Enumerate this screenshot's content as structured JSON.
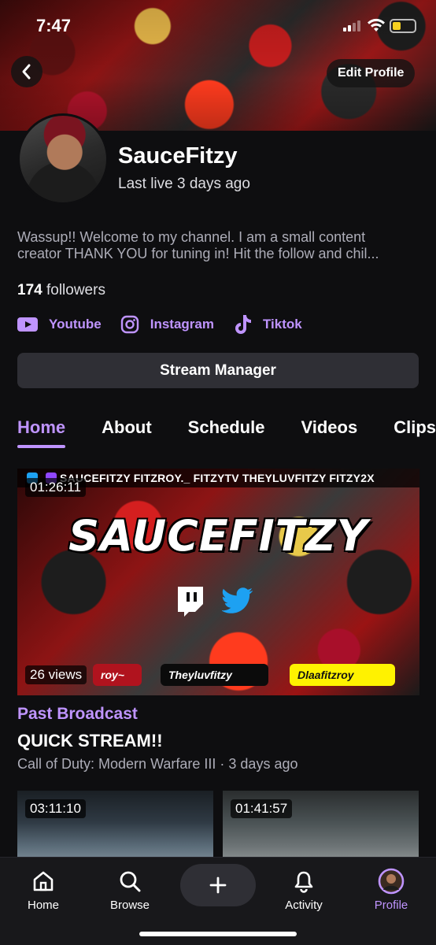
{
  "status_bar": {
    "time": "7:47"
  },
  "header": {
    "edit_profile_label": "Edit Profile"
  },
  "profile": {
    "channel_name": "SauceFitzy",
    "last_live": "Last live 3 days ago",
    "bio_line1": "Wassup!! Welcome to my channel. I am a small content",
    "bio_line2": "creator THANK YOU for tuning in! Hit the follow and chil...",
    "followers_count": "174",
    "followers_label": "followers"
  },
  "socials": [
    {
      "label": "Youtube",
      "icon": "youtube-icon"
    },
    {
      "label": "Instagram",
      "icon": "instagram-icon"
    },
    {
      "label": "Tiktok",
      "icon": "tiktok-icon"
    }
  ],
  "stream_manager_label": "Stream Manager",
  "tabs": [
    {
      "label": "Home",
      "active": true
    },
    {
      "label": "About"
    },
    {
      "label": "Schedule"
    },
    {
      "label": "Videos"
    },
    {
      "label": "Clips"
    }
  ],
  "featured": {
    "strip_text": "SAUCEFITZY  FITZROY._  FITZYTV  THEYLUVFITZY  FITZY2X",
    "thumb_title": "SAUCEFITZY",
    "duration": "01:26:11",
    "views": "26 views",
    "tags": [
      "roy~",
      "Theyluvfitzy",
      "Dlaafitzroy"
    ],
    "category": "Past Broadcast",
    "title": "QUICK STREAM!!",
    "meta": "Call of Duty: Modern Warfare III · 3 days ago"
  },
  "more_videos": [
    {
      "duration": "03:11:10"
    },
    {
      "duration": "01:41:57"
    }
  ],
  "bottom_nav": [
    {
      "label": "Home",
      "icon": "home-icon"
    },
    {
      "label": "Browse",
      "icon": "search-icon"
    },
    {
      "label": "Activity",
      "icon": "bell-icon"
    },
    {
      "label": "Profile",
      "icon": "profile-avatar-icon",
      "active": true
    }
  ],
  "colors": {
    "accent": "#bf94ff",
    "background": "#0e0e10",
    "button": "#2f2f35"
  }
}
